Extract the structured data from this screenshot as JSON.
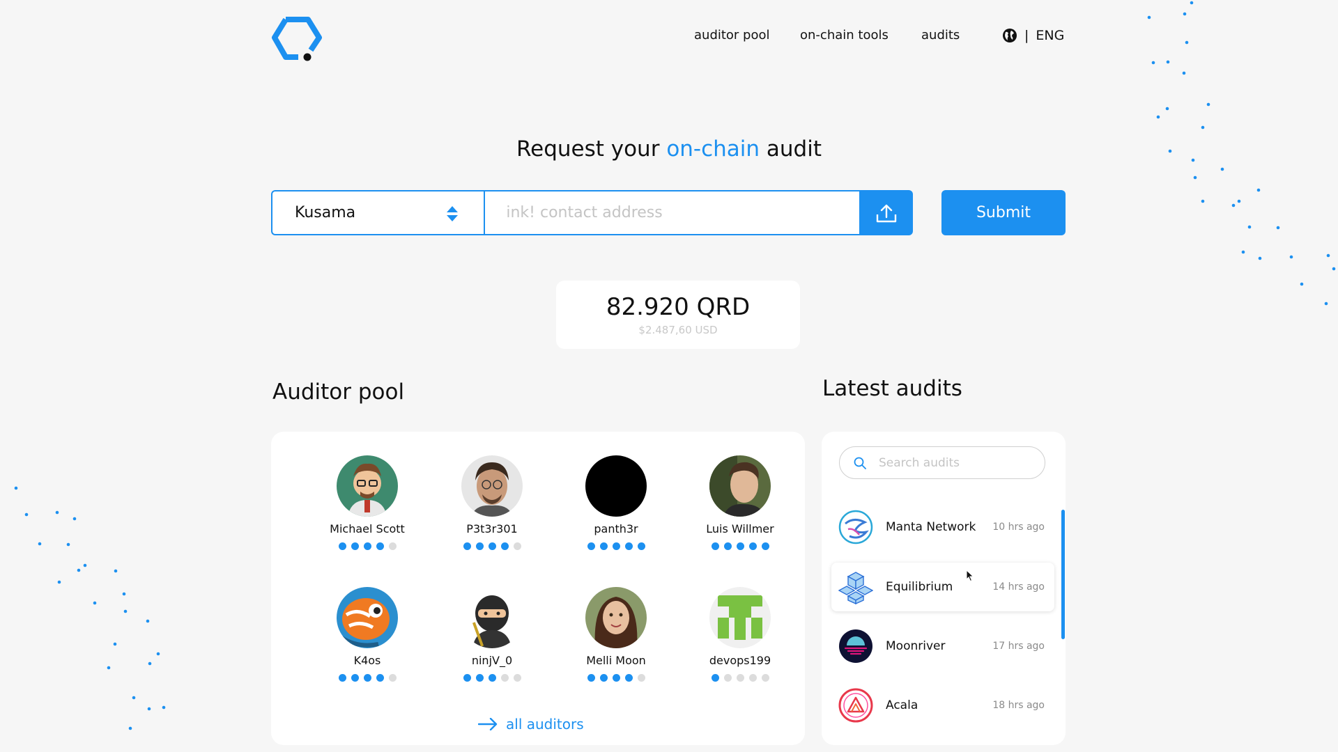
{
  "nav": {
    "items": [
      "auditor pool",
      "on-chain tools",
      "audits"
    ],
    "language": "ENG"
  },
  "hero": {
    "title_prefix": "Request your ",
    "title_accent": "on-chain",
    "title_suffix": " audit"
  },
  "form": {
    "network": "Kusama",
    "address_placeholder": "ink! contact address",
    "submit_label": "Submit"
  },
  "price": {
    "amount": "82.920 QRD",
    "usd": "$2.487,60 USD"
  },
  "auditor_pool": {
    "title": "Auditor pool",
    "all_link": "all auditors",
    "auditors": [
      {
        "name": "Michael Scott",
        "rating": 4
      },
      {
        "name": "P3t3r301",
        "rating": 4
      },
      {
        "name": "panth3r",
        "rating": 5
      },
      {
        "name": "Luis Willmer",
        "rating": 5
      },
      {
        "name": "K4os",
        "rating": 4
      },
      {
        "name": "ninjV_0",
        "rating": 3
      },
      {
        "name": "Melli Moon",
        "rating": 4
      },
      {
        "name": "devops199",
        "rating": 1
      }
    ]
  },
  "latest_audits": {
    "title": "Latest audits",
    "search_placeholder": "Search audits",
    "items": [
      {
        "name": "Manta Network",
        "time": "10 hrs ago"
      },
      {
        "name": "Equilibrium",
        "time": "14 hrs ago"
      },
      {
        "name": "Moonriver",
        "time": "17 hrs ago"
      },
      {
        "name": "Acala",
        "time": "18 hrs ago"
      }
    ]
  },
  "colors": {
    "accent": "#1c90f0",
    "background": "#f6f6f6"
  }
}
